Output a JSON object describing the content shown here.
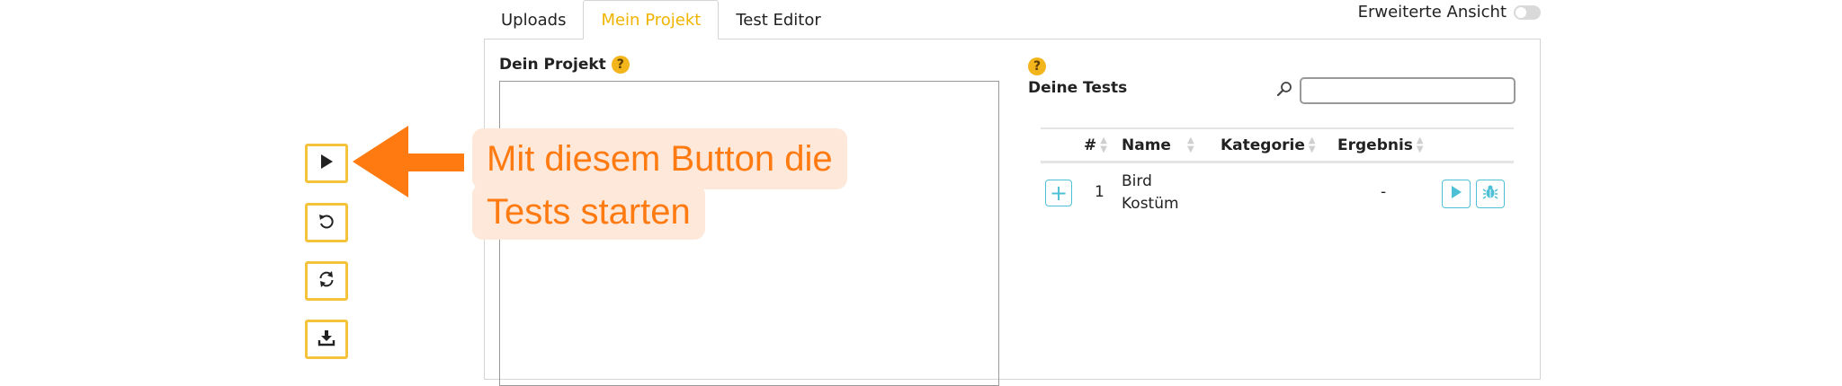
{
  "tabs": [
    {
      "label": "Uploads",
      "active": false
    },
    {
      "label": "Mein Projekt",
      "active": true
    },
    {
      "label": "Test Editor",
      "active": false
    }
  ],
  "advanced_view": {
    "label": "Erweiterte Ansicht",
    "enabled": false
  },
  "project": {
    "title": "Dein Projekt",
    "help": "?"
  },
  "tests": {
    "title": "Deine Tests",
    "help": "?",
    "search_value": "",
    "columns": [
      "#",
      "Name",
      "Kategorie",
      "Ergebnis"
    ],
    "rows": [
      {
        "num": "1",
        "name_line1": "Bird",
        "name_line2": "Kostüm",
        "category": "",
        "result": "-"
      }
    ]
  },
  "toolbar": {
    "buttons": [
      {
        "name": "run-tests-button",
        "icon": "play-icon"
      },
      {
        "name": "undo-button",
        "icon": "undo-icon"
      },
      {
        "name": "refresh-button",
        "icon": "refresh-icon"
      },
      {
        "name": "download-button",
        "icon": "download-icon"
      }
    ]
  },
  "annotation": {
    "line1": "Mit diesem Button die",
    "line2": "Tests starten"
  },
  "colors": {
    "accent": "#f0b400",
    "button_border": "#f5c33b",
    "annotation_text": "#ff7a10",
    "annotation_bg": "#fde8da",
    "arrow": "#ff7a10",
    "action": "#4ec0d6"
  }
}
